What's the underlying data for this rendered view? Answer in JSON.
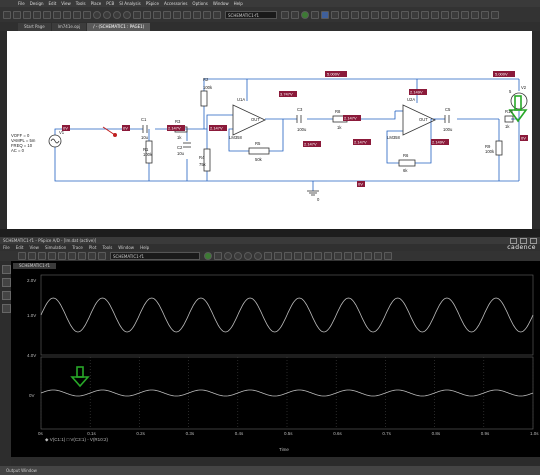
{
  "top_menu": [
    "File",
    "Design",
    "Edit",
    "View",
    "Tools",
    "Place",
    "PCB",
    "SI Analysis",
    "PSpice",
    "Accessories",
    "Options",
    "Window",
    "Help"
  ],
  "profile_dropdown": "SCHEMATIC1-f1",
  "tabs": [
    "Start Page",
    "lm741e.opj",
    "/ - (SCHEMATIC1 : PAGE1)"
  ],
  "components": {
    "v1": {
      "ref": "V1",
      "params": [
        "VOFF = 0",
        "VAMPL = 5m",
        "FREQ = 10",
        "AC = 0"
      ]
    },
    "c1": {
      "ref": "C1",
      "value": "10u"
    },
    "r1": {
      "ref": "R1",
      "value": "100k"
    },
    "r2": {
      "ref": "R2",
      "value": "100k"
    },
    "r3": {
      "ref": "R3",
      "value": "1k"
    },
    "c2": {
      "ref": "C2",
      "value": "10u"
    },
    "r4": {
      "ref": "R4",
      "value": "75k"
    },
    "u1a": {
      "ref": "U1A",
      "part": "LM358",
      "out": "OUT"
    },
    "r5": {
      "ref": "R5",
      "value": "50k"
    },
    "c3": {
      "ref": "C3",
      "value": "100u"
    },
    "r8": {
      "ref": "R8",
      "value": "1k"
    },
    "u2a": {
      "ref": "U2A",
      "part": "LM358",
      "out": "OUT"
    },
    "r6": {
      "ref": "R6",
      "value": "6k"
    },
    "c5": {
      "ref": "C5",
      "value": "100u"
    },
    "r9": {
      "ref": "R9",
      "value": "100k"
    },
    "r10": {
      "ref": "R10",
      "value": "1k"
    },
    "v2": {
      "ref": "V2",
      "value": "5"
    },
    "ground": {
      "label": "0"
    }
  },
  "voltage_markers": {
    "v_top1": "5.000V",
    "v_top2": "5.000V",
    "v_0a": "0V",
    "v_0b": "0V",
    "v_0c": "0V",
    "v_0d": "0V",
    "v_147a": "2.147V",
    "v_147b": "2.147V",
    "v_147c": "2.147V",
    "v_147d": "2.147V",
    "v_147e": "2.147V",
    "v_149a": "2.149V",
    "v_149b": "2.149V",
    "v_u1": "3.747V"
  },
  "probe_window": {
    "title": "SCHEMATIC1-f1 - PSpice A/D - [lm.dat (active)]",
    "menu": [
      "File",
      "Edit",
      "View",
      "Simulation",
      "Trace",
      "Plot",
      "Tools",
      "Window",
      "Help"
    ],
    "brand": "cadence",
    "plot_tab": "SCHEMATIC1-f1",
    "profile_dropdown": "SCHEMATIC1-f1",
    "upper_y_ticks": [
      "2.0V",
      "1.0V"
    ],
    "lower_y_ticks": [
      "4.0V",
      "0V"
    ],
    "x_ticks": [
      "0s",
      "0.1s",
      "0.2s",
      "0.3s",
      "0.4s",
      "0.5s",
      "0.6s",
      "0.7s",
      "0.8s",
      "0.9s",
      "1.0s"
    ],
    "x_label": "Time",
    "trace_legend": "◆ V(C1:1)  □ V(C3:1) - V(R10:2)",
    "output_window": "Output Window"
  },
  "colors": {
    "wire": "#2060c0",
    "marker_bg": "#8b1a3a",
    "arrow": "#28a828",
    "trace": "#bbbbbb"
  }
}
